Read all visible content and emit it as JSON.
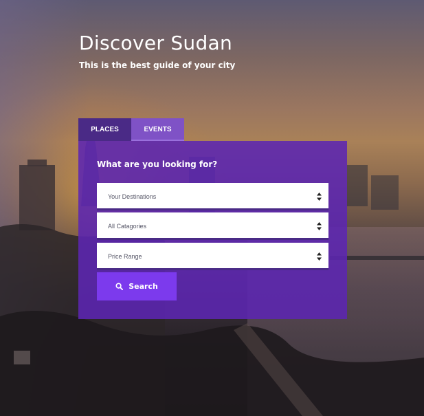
{
  "hero": {
    "title": "Discover Sudan",
    "subtitle": "This is the best guide of your city"
  },
  "tabs": [
    {
      "label": "PLACES",
      "active": true
    },
    {
      "label": "EVENTS",
      "active": false
    }
  ],
  "search": {
    "heading": "What are you looking for?",
    "fields": [
      {
        "selected": "Your Destinations",
        "icon": "select-arrows-icon"
      },
      {
        "selected": "All Catagories",
        "icon": "select-arrows-icon"
      },
      {
        "selected": "Price Range",
        "icon": "select-arrows-icon"
      }
    ],
    "button_label": "Search",
    "button_icon": "search-icon"
  },
  "colors": {
    "panel": "#5c26b2",
    "tab_active": "#4a2a86",
    "tab_inactive": "#7f52c6",
    "button": "#7c3aed",
    "text": "#ffffff"
  }
}
